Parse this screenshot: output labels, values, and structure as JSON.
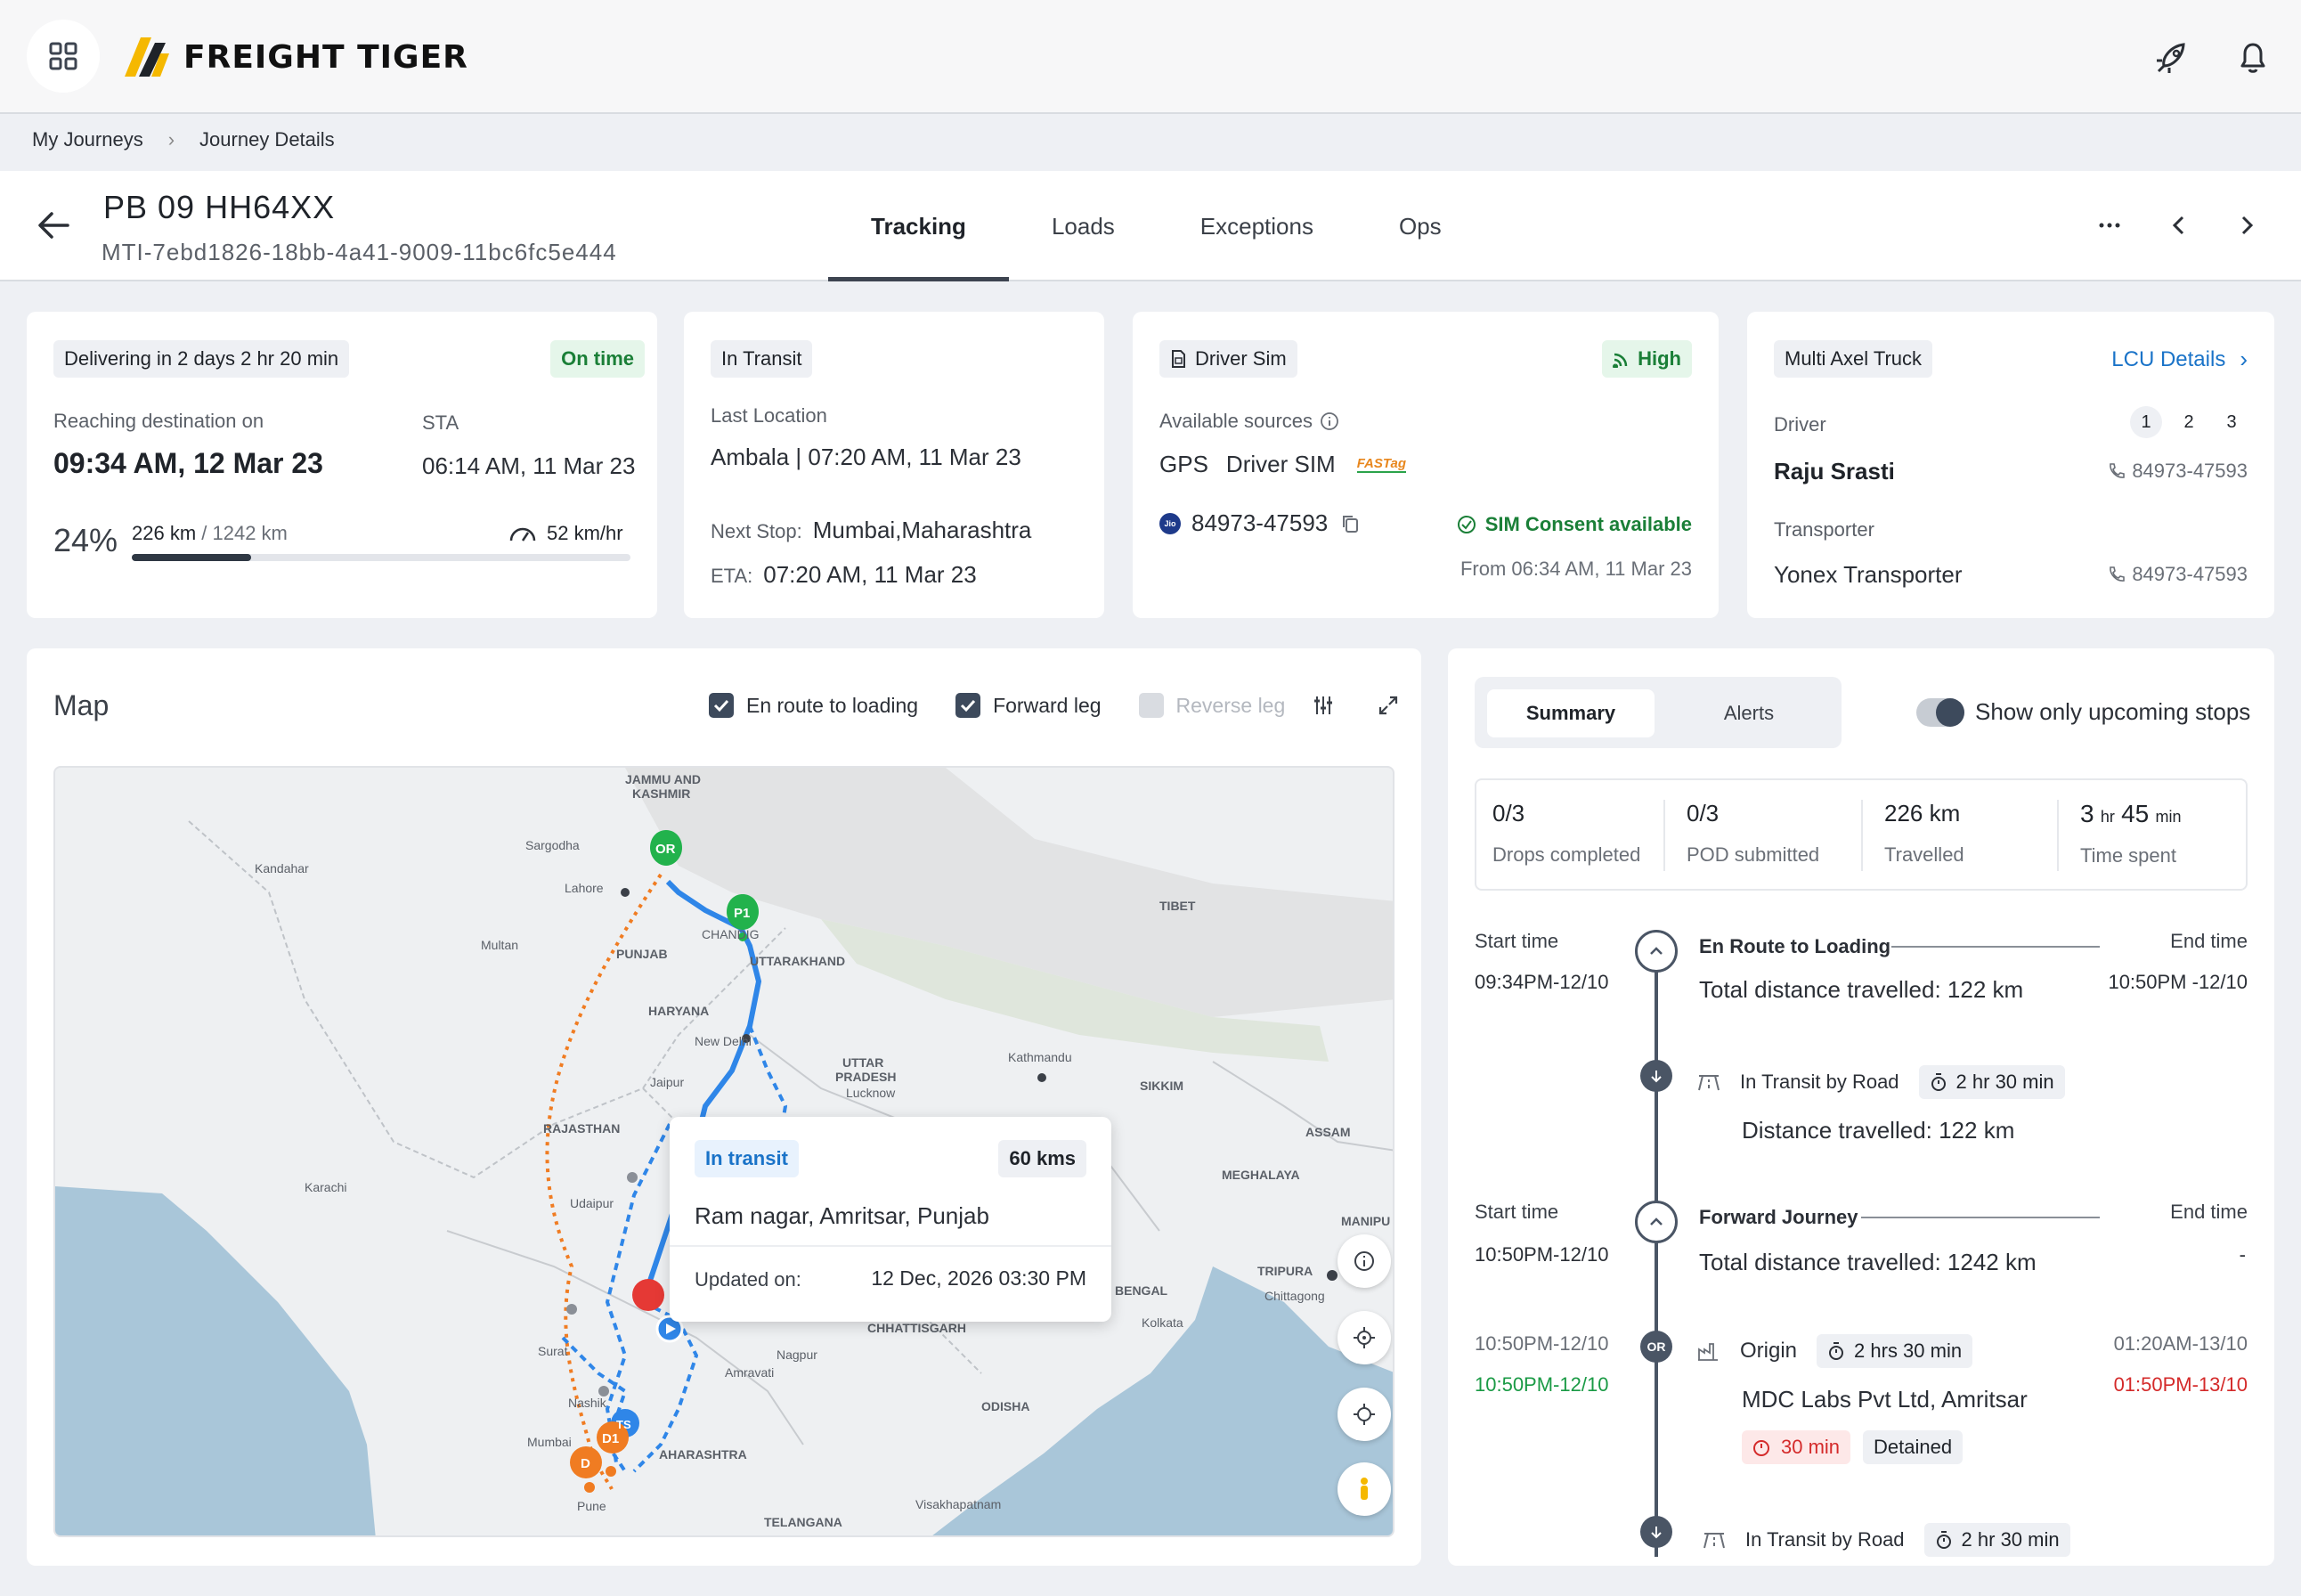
{
  "brand": {
    "name": "FREIGHT TIGER"
  },
  "icons": {
    "grid": "grid-icon",
    "rocket": "rocket-icon",
    "bell": "bell-icon",
    "back": "arrow-left-icon",
    "more": "more-horizontal-icon",
    "prev": "chevron-left-icon",
    "next": "chevron-right-icon"
  },
  "breadcrumb": {
    "items": [
      "My Journeys",
      "Journey Details"
    ]
  },
  "header": {
    "vehicle_number": "PB 09 HH64XX",
    "journey_id": "MTI-7ebd1826-18bb-4a41-9009-11bc6fc5e444",
    "tabs": [
      "Tracking",
      "Loads",
      "Exceptions",
      "Ops"
    ],
    "active_tab": "Tracking"
  },
  "delivery_card": {
    "chip": "Delivering in 2 days 2 hr 20 min",
    "status": "On time",
    "reaching_label": "Reaching destination on",
    "reaching_value": "09:34 AM, 12 Mar 23",
    "sta_label": "STA",
    "sta_value": "06:14 AM, 11 Mar 23",
    "progress_percent": "24%",
    "progress_fraction": 0.24,
    "distance_done": "226 km",
    "distance_total": "/ 1242 km",
    "speed": "52 km/hr"
  },
  "transit_card": {
    "chip": "In Transit",
    "last_location_label": "Last Location",
    "last_location_value": "Ambala | 07:20 AM, 11 Mar 23",
    "next_stop_label": "Next Stop:",
    "next_stop_value": "Mumbai,Maharashtra",
    "eta_label": "ETA:",
    "eta_value": "07:20 AM, 11 Mar 23"
  },
  "sim_card": {
    "chip": "Driver Sim",
    "signal": "High",
    "sources_label": "Available sources",
    "sources": [
      "GPS",
      "Driver SIM"
    ],
    "fastag": "FASTag",
    "jio": "Jio",
    "phone": "84973-47593",
    "consent": "SIM Consent available",
    "consent_from": "From 06:34 AM, 11 Mar 23"
  },
  "truck_card": {
    "chip": "Multi Axel Truck",
    "lcu_link": "LCU Details",
    "driver_label": "Driver",
    "driver_pages": [
      "1",
      "2",
      "3"
    ],
    "driver_name": "Raju Srasti",
    "driver_phone": "84973-47593",
    "transporter_label": "Transporter",
    "transporter_name": "Yonex Transporter",
    "transporter_phone": "84973-47593"
  },
  "map": {
    "title": "Map",
    "filters": [
      {
        "label": "En route to loading",
        "checked": true
      },
      {
        "label": "Forward leg",
        "checked": true
      },
      {
        "label": "Reverse leg",
        "checked": false
      }
    ],
    "labels": {
      "jk": "JAMMU AND",
      "jk2": "KASHMIR",
      "tibet": "TIBET",
      "punjab": "PUNJAB",
      "uttarakhand": "UTTARAKHAND",
      "haryana": "HARYANA",
      "rajasthan": "RAJASTHAN",
      "up": "UTTAR",
      "up2": "PRADESH",
      "sikkim": "SIKKIM",
      "assam": "ASSAM",
      "meghalaya": "MEGHALAYA",
      "manipur": "MANIPU",
      "tripura": "TRIPURA",
      "bengal": "BENGAL",
      "chhattisgarh": "CHHATTISGARH",
      "odisha": "ODISHA",
      "maharashtra": "AHARASHTRA",
      "telangana": "TELANGANA",
      "karachi": "Karachi",
      "lahore": "Lahore",
      "multan": "Multan",
      "jaipur": "Jaipur",
      "newdelhi": "New Delhi",
      "kathmandu": "Kathmandu",
      "lucknow": "Lucknow",
      "nagpur": "Nagpur",
      "surat": "Surat",
      "nashik": "Nashik",
      "mumbai": "Mumbai",
      "pune": "Pune",
      "kolkata": "Kolkata",
      "visakhapatnam": "Visakhapatnam",
      "chandigarh": "CHANDIG",
      "amravati": "Amravati",
      "udaipur": "Udaipur",
      "chittagong": "Chittagong",
      "sargodha": "Sargodha",
      "kandahar": "Kandahar"
    },
    "markers": {
      "origin": "OR",
      "pickup": "P1",
      "drop1": "D1",
      "drop": "D",
      "ts": "TS"
    },
    "popup": {
      "status": "In transit",
      "distance": "60 kms",
      "location": "Ram nagar, Amritsar, Punjab",
      "updated_label": "Updated on:",
      "updated_value": "12 Dec, 2026 03:30 PM"
    }
  },
  "summary": {
    "tabs": [
      "Summary",
      "Alerts"
    ],
    "active_tab": "Summary",
    "toggle_label": "Show only upcoming stops",
    "toggle_on": true,
    "stats": [
      {
        "value": "0/3",
        "label": "Drops completed"
      },
      {
        "value": "0/3",
        "label": "POD submitted"
      },
      {
        "value": "226 km",
        "label": "Travelled"
      },
      {
        "value_h": "3",
        "unit_h": "hr",
        "value_m": "45",
        "unit_m": "min",
        "label": "Time spent"
      }
    ],
    "timeline": {
      "leg1": {
        "start_label": "Start time",
        "start_time": "09:34PM-12/10",
        "title": "En Route to Loading",
        "distance": "Total distance travelled: 122 km",
        "end_label": "End time",
        "end_time": "10:50PM -12/10"
      },
      "transit1": {
        "title": "In Transit by Road",
        "duration": "2 hr 30 min",
        "distance": "Distance travelled: 122 km"
      },
      "leg2": {
        "start_label": "Start time",
        "start_time": "10:50PM-12/10",
        "title": "Forward Journey",
        "distance": "Total distance travelled: 1242 km",
        "end_label": "End time",
        "end_time": "-"
      },
      "origin": {
        "badge": "OR",
        "time_planned": "10:50PM-12/10",
        "time_actual": "10:50PM-12/10",
        "title": "Origin",
        "duration": "2 hrs 30 min",
        "place": "MDC Labs Pvt Ltd, Amritsar",
        "delay": "30 min",
        "status": "Detained",
        "end_planned": "01:20AM-13/10",
        "end_actual": "01:50PM-13/10"
      },
      "transit2": {
        "title": "In Transit by Road",
        "duration": "2 hr 30 min"
      }
    }
  },
  "colors": {
    "green": "#1a7f37",
    "blue_link": "#1a73c8",
    "red": "#d42a2a",
    "route_blue": "#2f86e8",
    "route_orange": "#f07c22",
    "marker_green": "#22b24c"
  }
}
